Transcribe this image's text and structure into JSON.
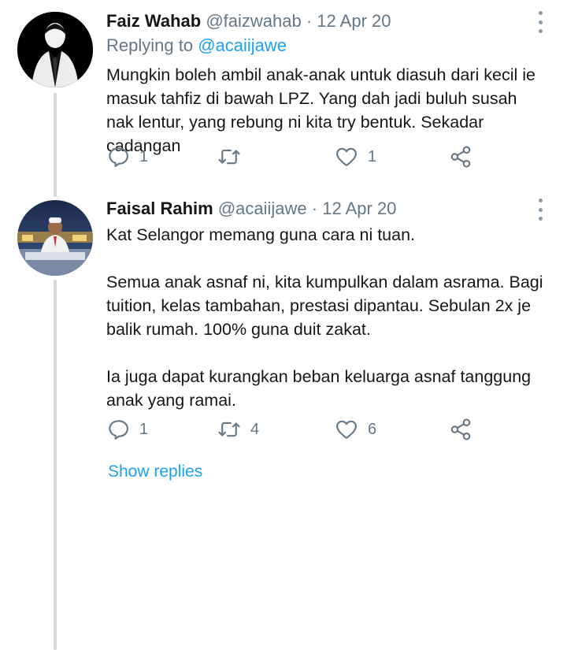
{
  "tweets": [
    {
      "name": "Faiz Wahab",
      "handle": "@faizwahab",
      "separator": " · ",
      "date": "12 Apr 20",
      "replying_label": "Replying to ",
      "replying_handle": "@acaiijawe",
      "paragraphs": [
        "Mungkin boleh ambil anak-anak untuk diasuh dari kecil ie masuk tahfiz di bawah LPZ. Yang dah jadi buluh susah nak lentur, yang rebung ni kita try bentuk. Sekadar cadangan"
      ],
      "reply_count": "1",
      "retweet_count": "",
      "like_count": "1",
      "avatar_icon": "suit-silhouette-avatar"
    },
    {
      "name": "Faisal Rahim",
      "handle": "@acaiijawe",
      "separator": " · ",
      "date": "12 Apr 20",
      "paragraphs": [
        "Kat Selangor memang guna cara ni tuan.",
        "Semua anak asnaf ni, kita kumpulkan dalam asrama. Bagi tuition, kelas tambahan, prestasi dipantau. Sebulan 2x je balik rumah. 100% guna duit zakat.",
        "Ia juga dapat kurangkan beban keluarga asnaf tanggung anak yang ramai."
      ],
      "reply_count": "1",
      "retweet_count": "4",
      "like_count": "6",
      "avatar_icon": "presenter-photo-avatar"
    }
  ],
  "show_replies_label": "Show replies",
  "colors": {
    "accent": "#1da1f2",
    "meta": "#657786",
    "text": "#14171a",
    "thread_line": "#cfd9de"
  },
  "icons": [
    "reply-icon",
    "retweet-icon",
    "like-icon",
    "share-icon",
    "more-options-icon"
  ]
}
